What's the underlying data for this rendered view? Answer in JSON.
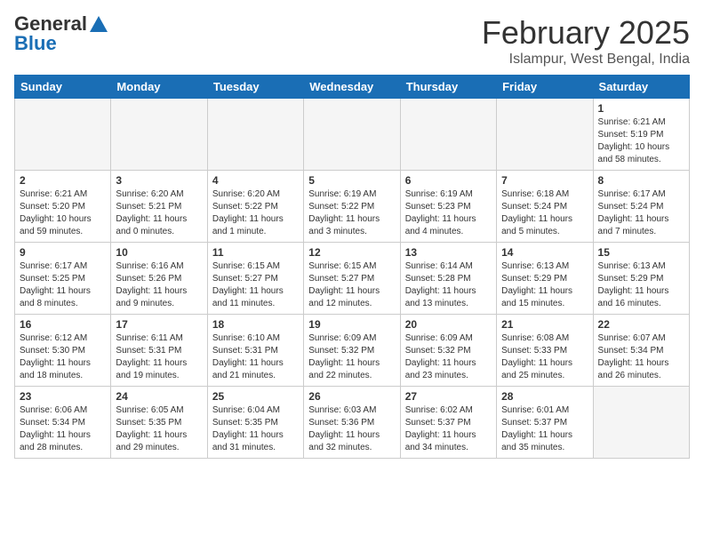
{
  "logo": {
    "general": "General",
    "blue": "Blue"
  },
  "header": {
    "month": "February 2025",
    "location": "Islampur, West Bengal, India"
  },
  "days_of_week": [
    "Sunday",
    "Monday",
    "Tuesday",
    "Wednesday",
    "Thursday",
    "Friday",
    "Saturday"
  ],
  "weeks": [
    [
      {
        "day": "",
        "info": ""
      },
      {
        "day": "",
        "info": ""
      },
      {
        "day": "",
        "info": ""
      },
      {
        "day": "",
        "info": ""
      },
      {
        "day": "",
        "info": ""
      },
      {
        "day": "",
        "info": ""
      },
      {
        "day": "1",
        "info": "Sunrise: 6:21 AM\nSunset: 5:19 PM\nDaylight: 10 hours and 58 minutes."
      }
    ],
    [
      {
        "day": "2",
        "info": "Sunrise: 6:21 AM\nSunset: 5:20 PM\nDaylight: 10 hours and 59 minutes."
      },
      {
        "day": "3",
        "info": "Sunrise: 6:20 AM\nSunset: 5:21 PM\nDaylight: 11 hours and 0 minutes."
      },
      {
        "day": "4",
        "info": "Sunrise: 6:20 AM\nSunset: 5:22 PM\nDaylight: 11 hours and 1 minute."
      },
      {
        "day": "5",
        "info": "Sunrise: 6:19 AM\nSunset: 5:22 PM\nDaylight: 11 hours and 3 minutes."
      },
      {
        "day": "6",
        "info": "Sunrise: 6:19 AM\nSunset: 5:23 PM\nDaylight: 11 hours and 4 minutes."
      },
      {
        "day": "7",
        "info": "Sunrise: 6:18 AM\nSunset: 5:24 PM\nDaylight: 11 hours and 5 minutes."
      },
      {
        "day": "8",
        "info": "Sunrise: 6:17 AM\nSunset: 5:24 PM\nDaylight: 11 hours and 7 minutes."
      }
    ],
    [
      {
        "day": "9",
        "info": "Sunrise: 6:17 AM\nSunset: 5:25 PM\nDaylight: 11 hours and 8 minutes."
      },
      {
        "day": "10",
        "info": "Sunrise: 6:16 AM\nSunset: 5:26 PM\nDaylight: 11 hours and 9 minutes."
      },
      {
        "day": "11",
        "info": "Sunrise: 6:15 AM\nSunset: 5:27 PM\nDaylight: 11 hours and 11 minutes."
      },
      {
        "day": "12",
        "info": "Sunrise: 6:15 AM\nSunset: 5:27 PM\nDaylight: 11 hours and 12 minutes."
      },
      {
        "day": "13",
        "info": "Sunrise: 6:14 AM\nSunset: 5:28 PM\nDaylight: 11 hours and 13 minutes."
      },
      {
        "day": "14",
        "info": "Sunrise: 6:13 AM\nSunset: 5:29 PM\nDaylight: 11 hours and 15 minutes."
      },
      {
        "day": "15",
        "info": "Sunrise: 6:13 AM\nSunset: 5:29 PM\nDaylight: 11 hours and 16 minutes."
      }
    ],
    [
      {
        "day": "16",
        "info": "Sunrise: 6:12 AM\nSunset: 5:30 PM\nDaylight: 11 hours and 18 minutes."
      },
      {
        "day": "17",
        "info": "Sunrise: 6:11 AM\nSunset: 5:31 PM\nDaylight: 11 hours and 19 minutes."
      },
      {
        "day": "18",
        "info": "Sunrise: 6:10 AM\nSunset: 5:31 PM\nDaylight: 11 hours and 21 minutes."
      },
      {
        "day": "19",
        "info": "Sunrise: 6:09 AM\nSunset: 5:32 PM\nDaylight: 11 hours and 22 minutes."
      },
      {
        "day": "20",
        "info": "Sunrise: 6:09 AM\nSunset: 5:32 PM\nDaylight: 11 hours and 23 minutes."
      },
      {
        "day": "21",
        "info": "Sunrise: 6:08 AM\nSunset: 5:33 PM\nDaylight: 11 hours and 25 minutes."
      },
      {
        "day": "22",
        "info": "Sunrise: 6:07 AM\nSunset: 5:34 PM\nDaylight: 11 hours and 26 minutes."
      }
    ],
    [
      {
        "day": "23",
        "info": "Sunrise: 6:06 AM\nSunset: 5:34 PM\nDaylight: 11 hours and 28 minutes."
      },
      {
        "day": "24",
        "info": "Sunrise: 6:05 AM\nSunset: 5:35 PM\nDaylight: 11 hours and 29 minutes."
      },
      {
        "day": "25",
        "info": "Sunrise: 6:04 AM\nSunset: 5:35 PM\nDaylight: 11 hours and 31 minutes."
      },
      {
        "day": "26",
        "info": "Sunrise: 6:03 AM\nSunset: 5:36 PM\nDaylight: 11 hours and 32 minutes."
      },
      {
        "day": "27",
        "info": "Sunrise: 6:02 AM\nSunset: 5:37 PM\nDaylight: 11 hours and 34 minutes."
      },
      {
        "day": "28",
        "info": "Sunrise: 6:01 AM\nSunset: 5:37 PM\nDaylight: 11 hours and 35 minutes."
      },
      {
        "day": "",
        "info": ""
      }
    ]
  ]
}
